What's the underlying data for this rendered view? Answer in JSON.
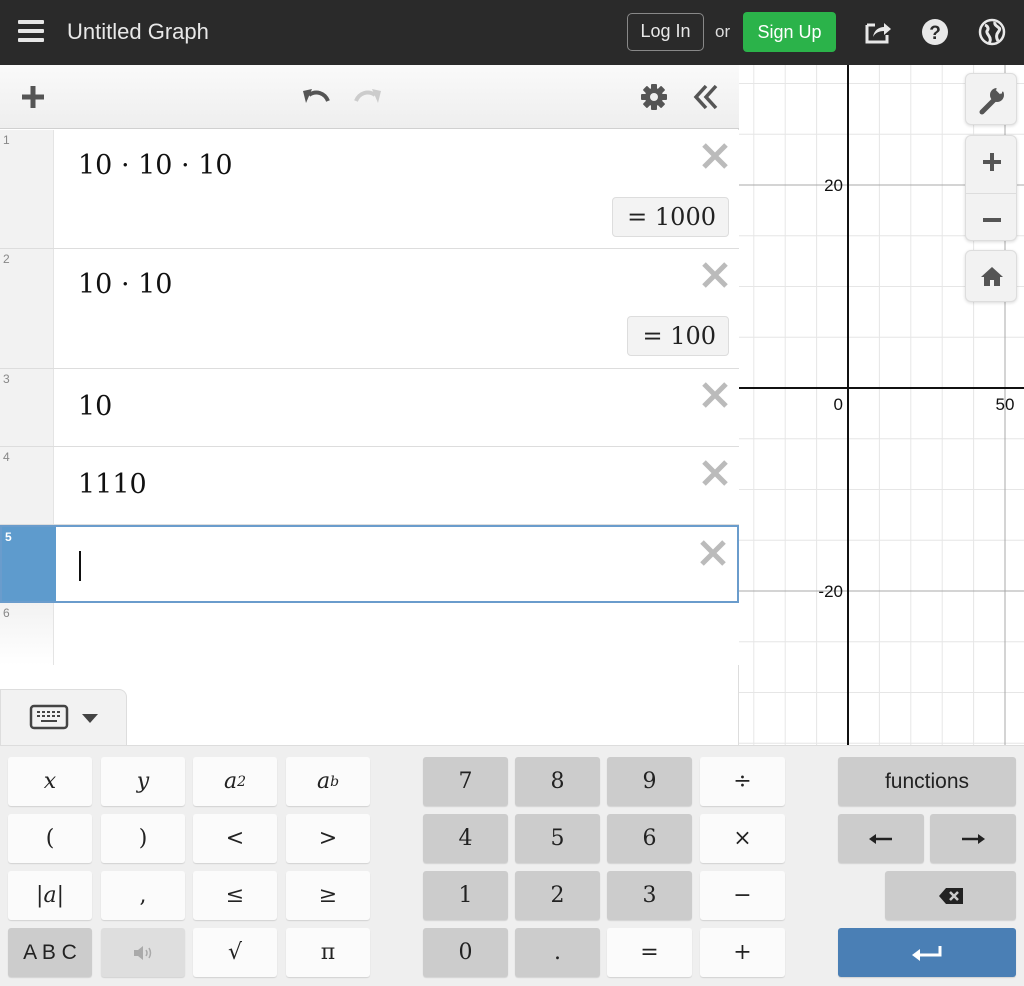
{
  "topbar": {
    "title": "Untitled Graph",
    "login_label": "Log In",
    "or_label": "or",
    "signup_label": "Sign Up",
    "icons": [
      "menu-icon",
      "share-icon",
      "help-icon",
      "globe-icon"
    ],
    "signup_color": "#2bb34a"
  },
  "expression_toolbar": {
    "icons": [
      "add-icon",
      "undo-icon",
      "redo-icon",
      "settings-icon",
      "collapse-icon"
    ]
  },
  "expressions": [
    {
      "number": "1",
      "latex": "10 · 10 · 10",
      "result": "= 1000"
    },
    {
      "number": "2",
      "latex": "10 · 10",
      "result": "= 100"
    },
    {
      "number": "3",
      "latex": "10",
      "result": null
    },
    {
      "number": "4",
      "latex": "1110",
      "result": null
    },
    {
      "number": "5",
      "latex": "",
      "result": null,
      "active": true
    },
    {
      "number": "6",
      "latex": "",
      "result": null
    }
  ],
  "graph": {
    "x_tick_labels": [
      "0",
      "50"
    ],
    "y_tick_labels": [
      "20",
      "0",
      "-20"
    ],
    "x_range_visible": [
      -35,
      56
    ],
    "y_range_visible": [
      -35,
      32
    ],
    "x_major_step": 50,
    "x_minor_step": 10,
    "y_major_step": 20,
    "y_minor_step": 5,
    "controls": [
      "wrench-icon",
      "zoom-in-icon",
      "zoom-out-icon",
      "home-icon"
    ]
  },
  "keypad": {
    "toggle_icons": [
      "keyboard-icon",
      "caret-down-icon"
    ],
    "left": [
      [
        "x",
        "y",
        "a²",
        "aᵇ"
      ],
      [
        "(",
        ")",
        "<",
        ">"
      ],
      [
        "|a|",
        ",",
        "≤",
        "≥"
      ],
      [
        "A B C",
        "speaker",
        "√",
        "π"
      ]
    ],
    "numbers": [
      [
        "7",
        "8",
        "9",
        "÷"
      ],
      [
        "4",
        "5",
        "6",
        "×"
      ],
      [
        "1",
        "2",
        "3",
        "−"
      ],
      [
        "0",
        ".",
        "=",
        "+"
      ]
    ],
    "right": {
      "functions_label": "functions",
      "left_arrow": "←",
      "right_arrow": "→",
      "backspace": "backspace",
      "enter": "enter"
    },
    "enter_color": "#4a7fb5"
  },
  "active_row_color": "#5e9bcd"
}
